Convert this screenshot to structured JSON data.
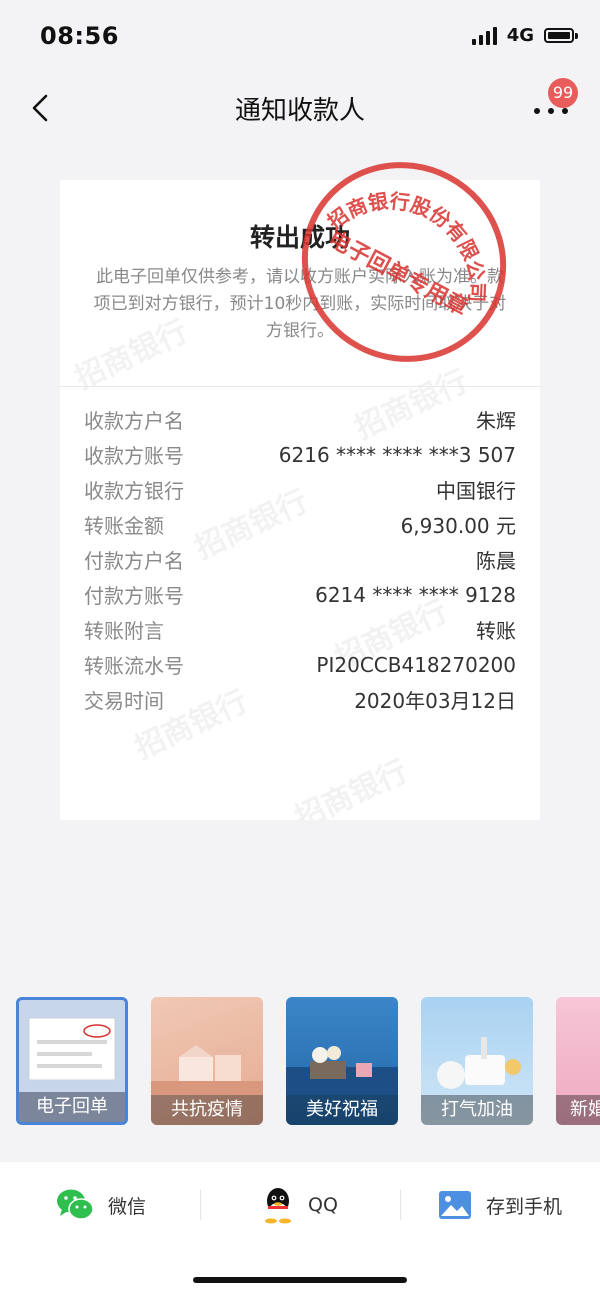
{
  "status_bar": {
    "time": "08:56",
    "network": "4G"
  },
  "nav": {
    "title": "通知收款人",
    "badge": "99"
  },
  "receipt": {
    "title": "转出成功",
    "note": "此电子回单仅供参考，请以收方账户实际入账为准。款项已到对方银行，预计10秒内到账，实际时间取决于对方银行。",
    "seal_text": "招商银行股份有限公司电子回单专用章",
    "watermark": "招商银行",
    "fields": [
      {
        "label": "收款方户名",
        "value": "朱辉"
      },
      {
        "label": "收款方账号",
        "value": "6216 **** **** ***3 507"
      },
      {
        "label": "收款方银行",
        "value": "中国银行"
      },
      {
        "label": "转账金额",
        "value": "6,930.00 元"
      },
      {
        "label": "付款方户名",
        "value": "陈晨"
      },
      {
        "label": "付款方账号",
        "value": "6214 **** **** 9128"
      },
      {
        "label": "转账附言",
        "value": "转账"
      },
      {
        "label": "转账流水号",
        "value": "PI20CCB418270200"
      },
      {
        "label": "交易时间",
        "value": "2020年03月12日"
      }
    ]
  },
  "templates": [
    {
      "label": "电子回单",
      "selected": true
    },
    {
      "label": "共抗疫情",
      "selected": false
    },
    {
      "label": "美好祝福",
      "selected": false
    },
    {
      "label": "打气加油",
      "selected": false
    },
    {
      "label": "新婚",
      "selected": false
    }
  ],
  "share": {
    "wechat": "微信",
    "qq": "QQ",
    "save": "存到手机"
  },
  "colors": {
    "accent": "#4a84d8",
    "seal": "#d8322e",
    "badge": "#e85c5c",
    "wechat": "#2fbf4f"
  }
}
